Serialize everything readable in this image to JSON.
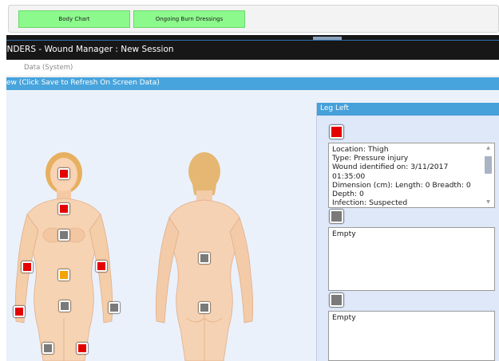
{
  "toolbar": {
    "tabs": [
      {
        "label": "Body Chart"
      },
      {
        "label": "Ongoing Burn Dressings"
      }
    ]
  },
  "window": {
    "title": "WINDERS - Wound Manager : New Session"
  },
  "subtabs": [
    {
      "label": "Data (System)"
    }
  ],
  "banner": {
    "text": "ew (Click Save to Refresh On Screen Data)"
  },
  "colors": {
    "red": "#e50000",
    "grey": "#7a7a7a",
    "orange": "#f4a300",
    "blue": "#46a0da"
  },
  "panel": {
    "title": "Leg Left",
    "entries": [
      {
        "marker_color": "red",
        "lines": [
          "Location: Thigh",
          "Type: Pressure injury",
          "Wound identified on: 3/11/2017",
          "01:35:00",
          "Dimension (cm):  Length: 0 Breadth: 0",
          "Depth: 0",
          "Infection: Suspected"
        ]
      },
      {
        "marker_color": "grey",
        "lines": [
          "Empty"
        ]
      },
      {
        "marker_color": "grey",
        "lines": [
          "Empty"
        ]
      }
    ]
  }
}
